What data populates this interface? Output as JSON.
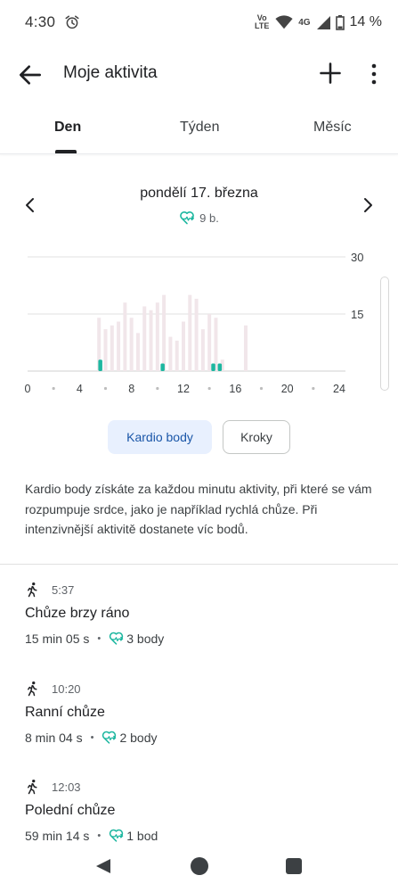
{
  "status_bar": {
    "time": "4:30",
    "network_volte": "Vo LTE",
    "network_type": "4G",
    "battery": "14 %"
  },
  "app_bar": {
    "title": "Moje aktivita"
  },
  "tabs": [
    {
      "label": "Den",
      "active": true
    },
    {
      "label": "Týden",
      "active": false
    },
    {
      "label": "Měsíc",
      "active": false
    }
  ],
  "date_header": {
    "date": "pondělí 17. března",
    "points": "9 b."
  },
  "chart_data": {
    "type": "bar",
    "xlabel": "",
    "ylabel": "",
    "x_ticks": [
      "0",
      "4",
      "8",
      "12",
      "16",
      "20",
      "24"
    ],
    "y_ticks": [
      "30",
      "15"
    ],
    "ylim": [
      0,
      30
    ],
    "xlim": [
      0,
      24
    ],
    "series": [
      {
        "values": [
          [
            5.5,
            14
          ],
          [
            6.0,
            11
          ],
          [
            6.5,
            12
          ],
          [
            7.0,
            13
          ],
          [
            7.5,
            18
          ],
          [
            8.0,
            14
          ],
          [
            8.5,
            10
          ],
          [
            9.0,
            17
          ],
          [
            9.5,
            16
          ],
          [
            10.0,
            18
          ],
          [
            10.5,
            20
          ],
          [
            11.0,
            9
          ],
          [
            11.5,
            8
          ],
          [
            12.0,
            13
          ],
          [
            12.5,
            20
          ],
          [
            13.0,
            19
          ],
          [
            13.5,
            11
          ],
          [
            14.0,
            15
          ],
          [
            14.5,
            14
          ],
          [
            15.0,
            3
          ],
          [
            16.8,
            12
          ]
        ],
        "color": "#f1e6ea"
      },
      {
        "values": [
          [
            5.6,
            3
          ],
          [
            10.4,
            2
          ],
          [
            14.3,
            2
          ],
          [
            14.8,
            2
          ]
        ],
        "color": "#1db7a0"
      }
    ]
  },
  "chips": {
    "selected": "Kardio body",
    "other": "Kroky"
  },
  "description": "Kardio body získáte za každou minutu aktivity, při které se vám rozpumpuje srdce, jako je například rychlá chůze. Při intenzivnější aktivitě dostanete víc bodů.",
  "activities": [
    {
      "time": "5:37",
      "title": "Chůze brzy ráno",
      "duration": "15 min 05 s",
      "points": "3 body"
    },
    {
      "time": "10:20",
      "title": "Ranní chůze",
      "duration": "8 min 04 s",
      "points": "2 body"
    },
    {
      "time": "12:03",
      "title": "Polední chůze",
      "duration": "59 min 14 s",
      "points": "1 bod"
    }
  ],
  "colors": {
    "accent_teal": "#1db7a0",
    "chip_selected_bg": "#e8f0fe",
    "chip_selected_text": "#1a56a8"
  },
  "icons": {
    "back": "arrow-left-icon",
    "add": "plus-icon",
    "more": "more-vert-icon",
    "prev": "chevron-left-icon",
    "next": "chevron-right-icon",
    "heart_points": "heart-points-icon",
    "walk": "walk-icon"
  }
}
